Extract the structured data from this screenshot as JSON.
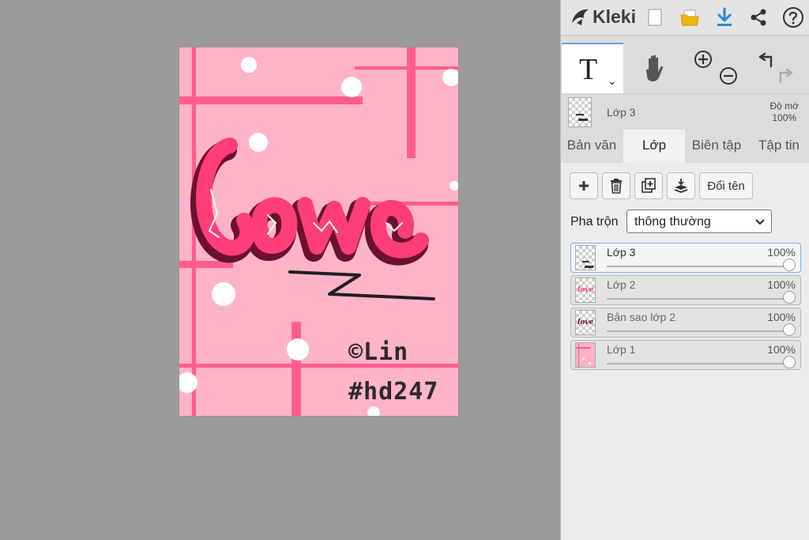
{
  "app": {
    "name": "Kleki"
  },
  "artwork": {
    "signature": "©Lin",
    "tag": "#hd247",
    "colors": {
      "background": "#ffb3c8",
      "stripes": "#ff5d8f",
      "lettering": "#ff3d78",
      "shadow": "#6b1030",
      "dots": "#ffffff"
    }
  },
  "toolbar": {
    "icons": [
      "new-file-icon",
      "open-folder-icon",
      "download-icon",
      "share-icon",
      "help-icon"
    ]
  },
  "tools": {
    "text_tool_glyph": "T",
    "text_tool_caret": "⌄"
  },
  "current_layer": {
    "name": "Lớp 3",
    "opacity_label": "Độ mờ",
    "opacity_value": "100%"
  },
  "tabs": [
    {
      "label": "Bản văn"
    },
    {
      "label": "Lớp"
    },
    {
      "label": "Biên tập"
    },
    {
      "label": "Tập tin"
    }
  ],
  "layer_actions": {
    "rename": "Đổi tên"
  },
  "blend": {
    "label": "Pha trộn",
    "value": "thông thường"
  },
  "layers": [
    {
      "name": "Lớp 3",
      "opacity": "100%",
      "opacity_fraction": 1.0
    },
    {
      "name": "Lớp 2",
      "opacity": "100%",
      "opacity_fraction": 1.0
    },
    {
      "name": "Bản sao lớp 2",
      "opacity": "100%",
      "opacity_fraction": 1.0
    },
    {
      "name": "Lớp 1",
      "opacity": "100%",
      "opacity_fraction": 1.0
    }
  ],
  "theme": {
    "accent": "#5aa2e6",
    "download_blue": "#2b86d9",
    "folder_yellow": "#f2b705"
  }
}
